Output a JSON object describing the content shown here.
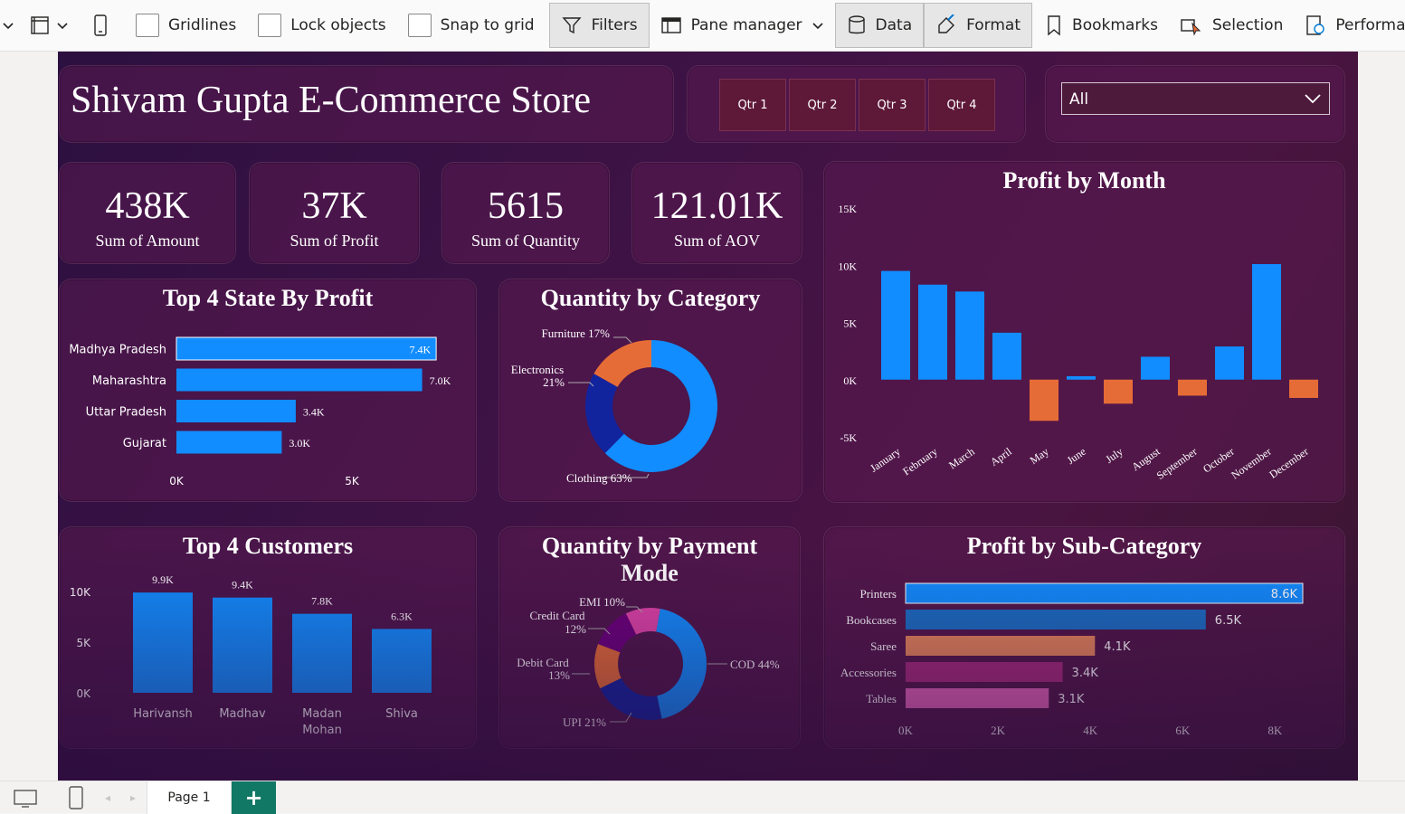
{
  "toolbar": {
    "gridlines": "Gridlines",
    "lock_objects": "Lock objects",
    "snap_to_grid": "Snap to grid",
    "filters": "Filters",
    "pane_manager": "Pane manager",
    "data": "Data",
    "format": "Format",
    "bookmarks": "Bookmarks",
    "selection": "Selection",
    "performance": "Performanc"
  },
  "header": {
    "title": "Shivam Gupta E-Commerce Store",
    "quarters": [
      "Qtr 1",
      "Qtr 2",
      "Qtr 3",
      "Qtr 4"
    ],
    "dropdown_value": "All"
  },
  "kpis": [
    {
      "value": "438K",
      "label": "Sum of Amount"
    },
    {
      "value": "37K",
      "label": "Sum of Profit"
    },
    {
      "value": "5615",
      "label": "Sum of Quantity"
    },
    {
      "value": "121.01K",
      "label": "Sum of AOV"
    }
  ],
  "chart_data": [
    {
      "id": "state",
      "type": "bar",
      "orientation": "horizontal",
      "title": "Top 4 State By Profit",
      "categories": [
        "Madhya Pradesh",
        "Maharashtra",
        "Uttar Pradesh",
        "Gujarat"
      ],
      "values": [
        7.4,
        7.0,
        3.4,
        3.0
      ],
      "labels": [
        "7.4K",
        "7.0K",
        "3.4K",
        "3.0K"
      ],
      "xticks": [
        "0K",
        "5K"
      ],
      "xlim": [
        0,
        7.5
      ],
      "color": "#118dff"
    },
    {
      "id": "category",
      "type": "pie",
      "donut": true,
      "title": "Quantity by Category",
      "slices": [
        {
          "name": "Clothing",
          "label": "Clothing 63%",
          "value": 63,
          "color": "#118dff"
        },
        {
          "name": "Electronics",
          "label": "Electronics 21%",
          "value": 21,
          "color": "#12239e"
        },
        {
          "name": "Furniture",
          "label": "Furniture 17%",
          "value": 17,
          "color": "#e66c37"
        }
      ]
    },
    {
      "id": "month",
      "type": "bar",
      "title": "Profit by Month",
      "categories": [
        "January",
        "February",
        "March",
        "April",
        "May",
        "June",
        "July",
        "August",
        "September",
        "October",
        "November",
        "December"
      ],
      "values": [
        9.5,
        8.3,
        7.7,
        4.1,
        -3.6,
        0.3,
        -2.1,
        2.0,
        -1.4,
        2.9,
        10.1,
        -1.6
      ],
      "yticks": [
        "15K",
        "10K",
        "5K",
        "0K",
        "-5K"
      ],
      "ylim": [
        -5,
        15
      ],
      "positive_color": "#118dff",
      "negative_color": "#e66c37"
    },
    {
      "id": "customers",
      "type": "bar",
      "title": "Top 4 Customers",
      "categories": [
        "Harivansh",
        "Madhav",
        "Madan Mohan",
        "Shiva"
      ],
      "values": [
        9.9,
        9.4,
        7.8,
        6.3
      ],
      "labels": [
        "9.9K",
        "9.4K",
        "7.8K",
        "6.3K"
      ],
      "yticks": [
        "10K",
        "5K",
        "0K"
      ],
      "ylim": [
        0,
        10
      ],
      "color": "#118dff"
    },
    {
      "id": "payment",
      "type": "pie",
      "donut": true,
      "title": "Quantity by Payment Mode",
      "slices": [
        {
          "name": "COD",
          "label": "COD 44%",
          "value": 44,
          "color": "#118dff"
        },
        {
          "name": "UPI",
          "label": "UPI 21%",
          "value": 21,
          "color": "#12239e"
        },
        {
          "name": "Debit Card",
          "label": "Debit Card 13%",
          "value": 13,
          "color": "#e66c37"
        },
        {
          "name": "Credit Card",
          "label": "Credit Card 12%",
          "value": 12,
          "color": "#6b007b"
        },
        {
          "name": "EMI",
          "label": "EMI 10%",
          "value": 10,
          "color": "#e044a7"
        }
      ]
    },
    {
      "id": "subcat",
      "type": "bar",
      "orientation": "horizontal",
      "title": "Profit by Sub-Category",
      "categories": [
        "Printers",
        "Bookcases",
        "Saree",
        "Accessories",
        "Tables"
      ],
      "values": [
        8.6,
        6.5,
        4.1,
        3.4,
        3.1
      ],
      "labels": [
        "8.6K",
        "6.5K",
        "4.1K",
        "3.4K",
        "3.1K"
      ],
      "colors": [
        "#118dff",
        "#1a6fc4",
        "#e8865a",
        "#a52a7a",
        "#e461b7"
      ],
      "xticks": [
        "0K",
        "2K",
        "4K",
        "6K",
        "8K"
      ],
      "xlim": [
        0,
        8.6
      ]
    }
  ],
  "tabs": {
    "page": "Page 1",
    "add": "+"
  }
}
